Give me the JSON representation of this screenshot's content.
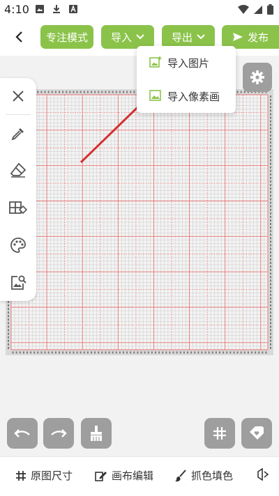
{
  "status_bar": {
    "time": "4:10"
  },
  "top_bar": {
    "focus_mode": "专注模式",
    "import": "导入",
    "export": "导出",
    "publish": "发布"
  },
  "dropdown": {
    "import_image": "导入图片",
    "import_pixel_art": "导入像素画"
  },
  "grid": {
    "columns": 72,
    "rows": 72,
    "line_color": "#e57373",
    "minor_line_color": "#c9c9c9",
    "cell_color": "#f3f3f3"
  },
  "bottom_bar": {
    "original_size": "原图尺寸",
    "canvas_edit": "画布编辑",
    "pick_color_fill": "抓色填色"
  },
  "colors": {
    "accent": "#8bc34a",
    "action_button": "#9e9e9e",
    "arrow": "#d32f2f"
  }
}
